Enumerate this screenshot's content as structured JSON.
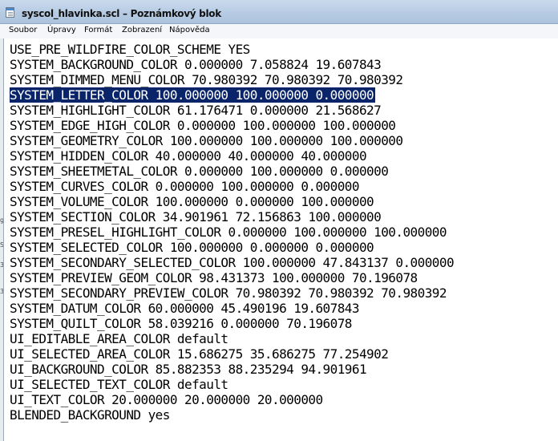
{
  "window": {
    "title": "syscol_hlavinka.scl – Poznámkový blok"
  },
  "menu": {
    "items": [
      "Soubor",
      "Úpravy",
      "Formát",
      "Zobrazení",
      "Nápověda"
    ]
  },
  "editor": {
    "lines": [
      "USE_PRE_WILDFIRE_COLOR_SCHEME YES",
      "SYSTEM_BACKGROUND_COLOR 0.000000 7.058824 19.607843",
      "SYSTEM_DIMMED_MENU_COLOR 70.980392 70.980392 70.980392",
      "SYSTEM_LETTER_COLOR 100.000000 100.000000 0.000000",
      "SYSTEM_HIGHLIGHT_COLOR 61.176471 0.000000 21.568627",
      "SYSTEM_EDGE_HIGH_COLOR 0.000000 100.000000 100.000000",
      "SYSTEM_GEOMETRY_COLOR 100.000000 100.000000 100.000000",
      "SYSTEM_HIDDEN_COLOR 40.000000 40.000000 40.000000",
      "SYSTEM_SHEETMETAL_COLOR 0.000000 100.000000 0.000000",
      "SYSTEM_CURVES_COLOR 0.000000 100.000000 0.000000",
      "SYSTEM_VOLUME_COLOR 100.000000 0.000000 100.000000",
      "SYSTEM_SECTION_COLOR 34.901961 72.156863 100.000000",
      "SYSTEM_PRESEL_HIGHLIGHT_COLOR 0.000000 100.000000 100.000000",
      "SYSTEM_SELECTED_COLOR 100.000000 0.000000 0.000000",
      "SYSTEM_SECONDARY_SELECTED_COLOR 100.000000 47.843137 0.000000",
      "SYSTEM_PREVIEW_GEOM_COLOR 98.431373 100.000000 70.196078",
      "SYSTEM_SECONDARY_PREVIEW_COLOR 70.980392 70.980392 70.980392",
      "SYSTEM_DATUM_COLOR 60.000000 45.490196 19.607843",
      "SYSTEM_QUILT_COLOR 58.039216 0.000000 70.196078",
      "UI_EDITABLE_AREA_COLOR default",
      "UI_SELECTED_AREA_COLOR 15.686275 35.686275 77.254902",
      "UI_BACKGROUND_COLOR 85.882353 88.235294 94.901961",
      "UI_SELECTED_TEXT_COLOR default",
      "UI_TEXT_COLOR 20.000000 20.000000 20.000000",
      "BLENDED_BACKGROUND yes"
    ],
    "selected_line": "SYSTEM_LETTER_COLOR 100.000000 100.000000 0.000000"
  },
  "left_strip": {
    "marks": [
      "g",
      "S",
      "3",
      "3"
    ]
  },
  "colors": {
    "selection": "#0a246a",
    "titlebar": "#b6cbe3",
    "text": "#000000"
  }
}
